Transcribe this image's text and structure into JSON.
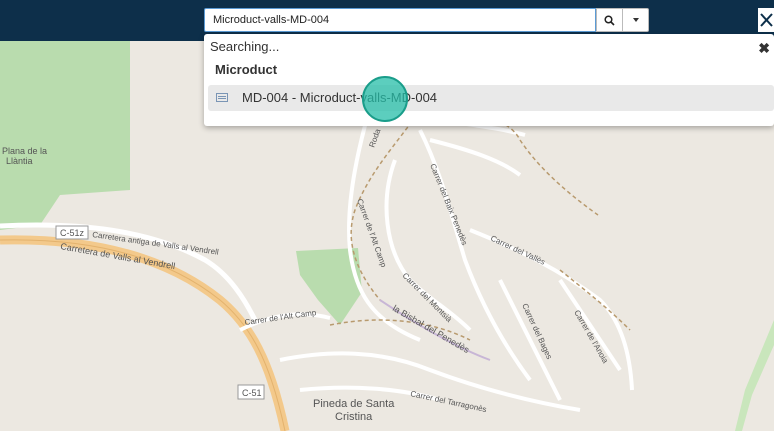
{
  "search": {
    "value": "Microduct-valls-MD-004"
  },
  "dropdown": {
    "status": "Searching...",
    "close_icon": "✖",
    "group_title": "Microduct",
    "results": [
      {
        "label": "MD-004 - Microduct-valls-MD-004",
        "icon": "table-icon"
      }
    ]
  },
  "map": {
    "labels": {
      "plana_1": "Plana de la",
      "plana_2": "Llàntia",
      "c51z": "C-51z",
      "carretera_antiga": "Carretera antiga de Valls al Vendrell",
      "carretera_valls": "Carretera de Valls al Vendrell",
      "c51": "C-51",
      "alt_camp_street": "Carrer de l'Alt Camp",
      "alt_camp_vertical": "Carrer de l'Alt Camp",
      "baix_penedes": "Carrer del Baix Penedès",
      "valles": "Carrer del Vallès",
      "montsia": "Carrer del Montsià",
      "bages": "Carrer del Bages",
      "anoia": "Carrer de l'Anoia",
      "bisbal": "la Bisbal del Penedès",
      "tarragones": "Carrer del Tarragonès",
      "pineda_1": "Pineda de Santa",
      "pineda_2": "Cristina",
      "road_fragment": "Roda"
    }
  }
}
